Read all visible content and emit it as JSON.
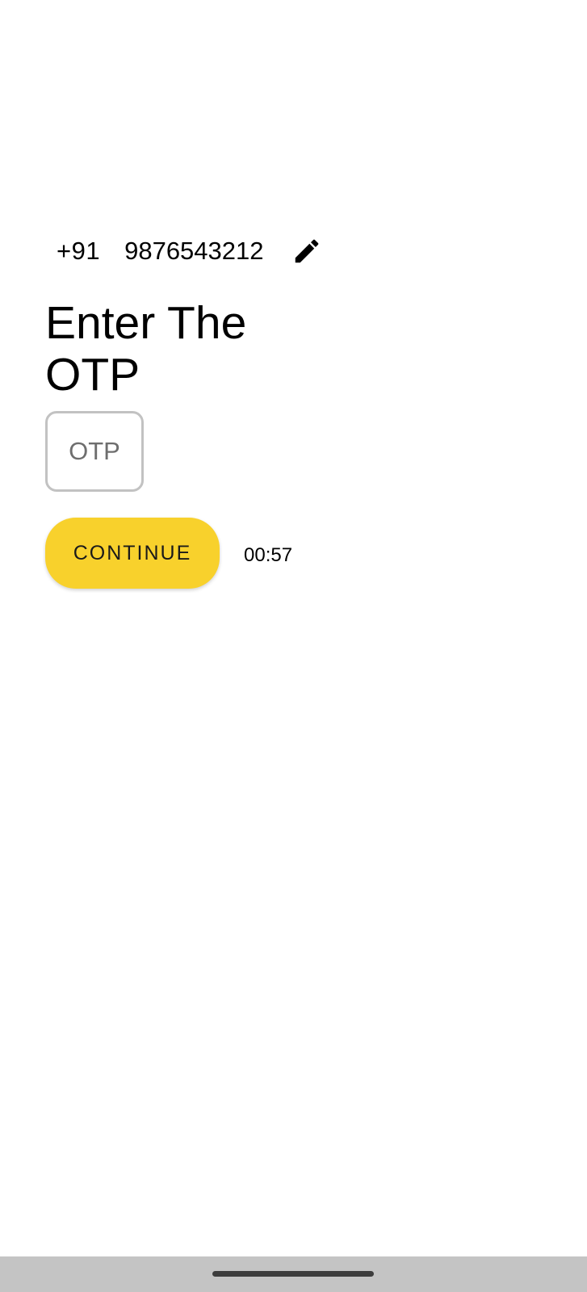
{
  "phone": {
    "country_code": "+91",
    "number": "9876543212",
    "edit_icon": "pencil-icon"
  },
  "title": "Enter The OTP",
  "otp_field": {
    "placeholder": "OTP",
    "value": ""
  },
  "continue_button": {
    "label": "CONTINUE",
    "color": "#f8d12c"
  },
  "timer": "00:57",
  "nav_bar": {
    "home_indicator": "home-indicator"
  }
}
